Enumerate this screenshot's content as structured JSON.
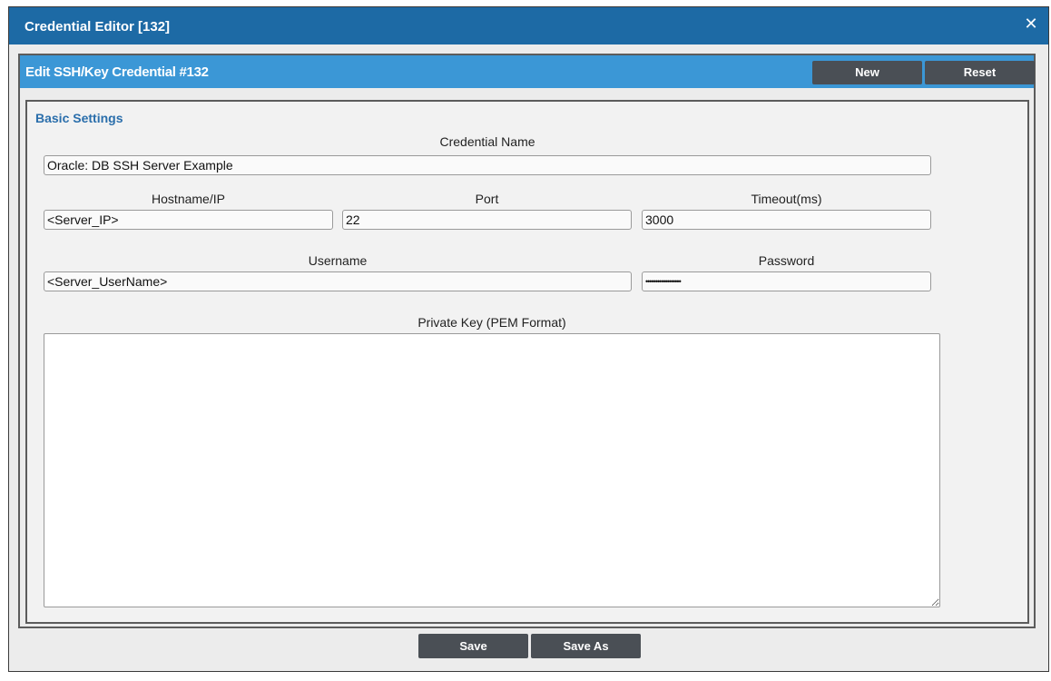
{
  "window": {
    "title": "Credential Editor [132]",
    "close_icon": "close-icon"
  },
  "panel": {
    "title": "Edit SSH/Key Credential #132",
    "buttons": {
      "new_label": "New",
      "reset_label": "Reset"
    }
  },
  "settings": {
    "section_title": "Basic Settings",
    "credential_name": {
      "label": "Credential Name",
      "value": "Oracle: DB SSH Server Example"
    },
    "hostname": {
      "label": "Hostname/IP",
      "value": "<Server_IP>"
    },
    "port": {
      "label": "Port",
      "value": "22"
    },
    "timeout": {
      "label": "Timeout(ms)",
      "value": "3000"
    },
    "username": {
      "label": "Username",
      "value": "<Server_UserName>"
    },
    "password": {
      "label": "Password",
      "value": "••••••••••••••••••"
    },
    "private_key": {
      "label": "Private Key (PEM Format)",
      "value": ""
    }
  },
  "footer": {
    "save_label": "Save",
    "save_as_label": "Save As"
  },
  "colors": {
    "titlebar": "#1d6aa5",
    "panel_header": "#3b97d6",
    "button": "#4a4f55",
    "section_label": "#2a6eab"
  }
}
